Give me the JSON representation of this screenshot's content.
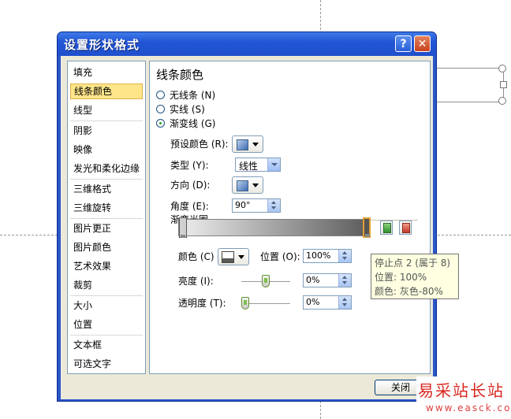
{
  "dialog": {
    "title": "设置形状格式",
    "help_label": "?",
    "close_glyph": "✕",
    "close_button": "关闭"
  },
  "nav": {
    "items": [
      {
        "label": "填充"
      },
      {
        "label": "线条颜色",
        "selected": true
      },
      {
        "label": "线型"
      },
      {
        "label": "阴影"
      },
      {
        "label": "映像"
      },
      {
        "label": "发光和柔化边缘"
      },
      {
        "label": "三维格式"
      },
      {
        "label": "三维旋转"
      },
      {
        "label": "图片更正"
      },
      {
        "label": "图片颜色"
      },
      {
        "label": "艺术效果"
      },
      {
        "label": "裁剪"
      },
      {
        "label": "大小"
      },
      {
        "label": "位置"
      },
      {
        "label": "文本框"
      },
      {
        "label": "可选文字"
      }
    ]
  },
  "panel": {
    "title": "线条颜色",
    "radios": [
      {
        "label": "无线条 (N)",
        "checked": false
      },
      {
        "label": "实线 (S)",
        "checked": false
      },
      {
        "label": "渐变线 (G)",
        "checked": true
      }
    ],
    "preset_label": "预设颜色 (R):",
    "type_label": "类型 (Y):",
    "type_value": "线性",
    "direction_label": "方向 (D):",
    "angle_label": "角度 (E):",
    "angle_value": "90°",
    "stops_label": "渐变光圈",
    "color_label": "颜色 (C)",
    "position_label": "位置 (O):",
    "position_value": "100%",
    "brightness_label": "亮度 (I):",
    "brightness_value": "0%",
    "transparency_label": "透明度 (T):",
    "transparency_value": "0%",
    "gradient_start_color": "#eeeeee",
    "gradient_end_color": "#5c5c5c"
  },
  "tooltip": {
    "line1": "停止点 2 (属于 8)",
    "line2": "位置: 100%",
    "line3": "颜色: 灰色-80%"
  },
  "watermark": {
    "text": "易采站长站",
    "url": "www.easck.com"
  }
}
